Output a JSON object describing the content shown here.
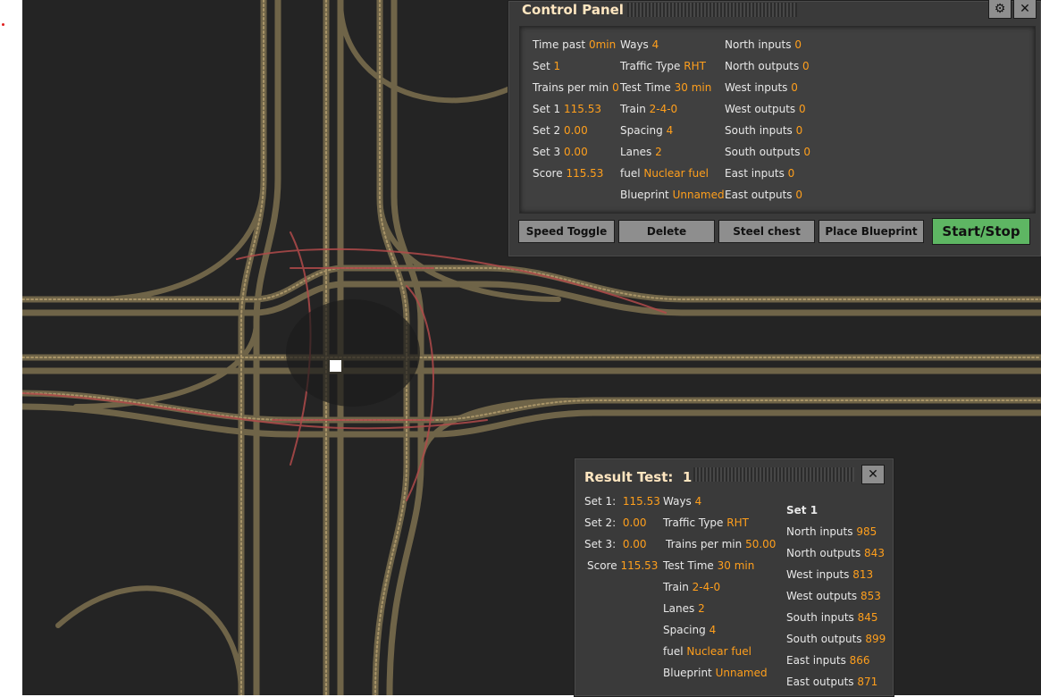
{
  "control_panel": {
    "title": "Control Panel",
    "col1": [
      {
        "label": "Time past",
        "value": "0min"
      },
      {
        "label": "Set",
        "value": "1"
      },
      {
        "label": "Trains per min",
        "value": "0"
      },
      {
        "label": "Set 1",
        "value": "115.53"
      },
      {
        "label": "Set 2",
        "value": "0.00"
      },
      {
        "label": "Set 3",
        "value": "0.00"
      },
      {
        "label": "Score",
        "value": "115.53"
      }
    ],
    "col2": [
      {
        "label": "Ways",
        "value": "4"
      },
      {
        "label": "Traffic Type",
        "value": "RHT"
      },
      {
        "label": "Test Time",
        "value": "30 min"
      },
      {
        "label": "Train",
        "value": "2-4-0"
      },
      {
        "label": "Spacing",
        "value": "4"
      },
      {
        "label": "Lanes",
        "value": "2"
      },
      {
        "label": "fuel",
        "value": "Nuclear fuel"
      },
      {
        "label": "Blueprint",
        "value": "Unnamed"
      }
    ],
    "col3": [
      {
        "label": "North inputs",
        "value": "0"
      },
      {
        "label": "North outputs",
        "value": "0"
      },
      {
        "label": "West inputs",
        "value": "0"
      },
      {
        "label": "West outputs",
        "value": "0"
      },
      {
        "label": "South inputs",
        "value": "0"
      },
      {
        "label": "South outputs",
        "value": "0"
      },
      {
        "label": "East inputs",
        "value": "0"
      },
      {
        "label": "East outputs",
        "value": "0"
      }
    ],
    "buttons": {
      "speed_toggle": "Speed Toggle",
      "delete": "Delete",
      "steel_chest": "Steel chest",
      "place_blueprint": "Place Blueprint",
      "start_stop": "Start/Stop"
    },
    "settings_icon": "gear-icon",
    "close_icon": "close-icon"
  },
  "result_panel": {
    "title": "Result Test:",
    "test_number": "1",
    "col1": [
      {
        "label": "Set 1:",
        "value": "115.53"
      },
      {
        "label": "Set 2:",
        "value": "0.00"
      },
      {
        "label": "Set 3:",
        "value": "0.00"
      },
      {
        "label": "Score",
        "value": "115.53"
      }
    ],
    "col2": [
      {
        "label": "Ways",
        "value": "4"
      },
      {
        "label": "Traffic Type",
        "value": "RHT"
      },
      {
        "label": "Trains per min",
        "value": "50.00"
      },
      {
        "label": "Test Time",
        "value": "30 min"
      },
      {
        "label": "Train",
        "value": "2-4-0"
      },
      {
        "label": "Lanes",
        "value": "2"
      },
      {
        "label": "Spacing",
        "value": "4"
      },
      {
        "label": "fuel",
        "value": "Nuclear fuel"
      },
      {
        "label": "Blueprint",
        "value": "Unnamed"
      }
    ],
    "col3_header": "Set 1",
    "col3": [
      {
        "label": "North inputs",
        "value": "985"
      },
      {
        "label": "North outputs",
        "value": "843"
      },
      {
        "label": "West inputs",
        "value": "813"
      },
      {
        "label": "West outputs",
        "value": "853"
      },
      {
        "label": "South inputs",
        "value": "845"
      },
      {
        "label": "South outputs",
        "value": "899"
      },
      {
        "label": "East inputs",
        "value": "866"
      },
      {
        "label": "East outputs",
        "value": "871"
      }
    ],
    "close_icon": "close-icon"
  },
  "colors": {
    "accent_value": "#ff9f1c",
    "start_button": "#5eb663",
    "rail": "#8a7a5a",
    "signal_rail": "#b04a4a",
    "ground": "#242424"
  }
}
